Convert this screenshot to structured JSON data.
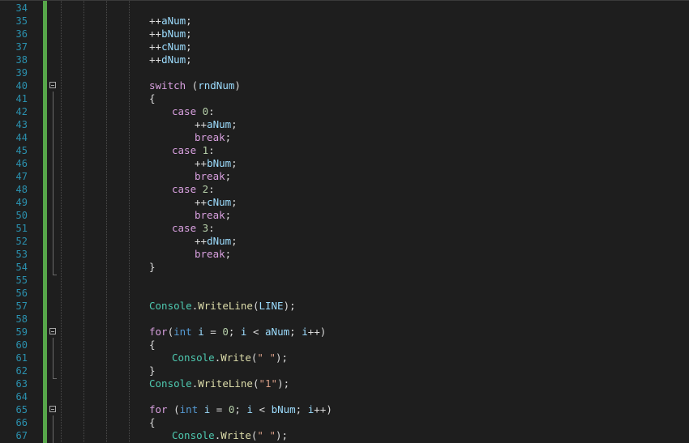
{
  "editor": {
    "language": "C#",
    "colors": {
      "background": "#1e1e1e",
      "line_number": "#2b91af",
      "change_bar": "#57a64a",
      "keyword": "#569cd6",
      "control_keyword": "#d8a0df",
      "type": "#4ec9b0",
      "method": "#dcdcaa",
      "variable": "#9cdcfe",
      "number": "#b5cea8",
      "string": "#d69d85"
    },
    "lines": [
      {
        "n": "34",
        "indent": 0,
        "tokens": []
      },
      {
        "n": "35",
        "indent": 0,
        "tokens": [
          [
            "pun",
            "++"
          ],
          [
            "var",
            "aNum"
          ],
          [
            "pun",
            ";"
          ]
        ]
      },
      {
        "n": "36",
        "indent": 0,
        "tokens": [
          [
            "pun",
            "++"
          ],
          [
            "var",
            "bNum"
          ],
          [
            "pun",
            ";"
          ]
        ]
      },
      {
        "n": "37",
        "indent": 0,
        "tokens": [
          [
            "pun",
            "++"
          ],
          [
            "var",
            "cNum"
          ],
          [
            "pun",
            ";"
          ]
        ]
      },
      {
        "n": "38",
        "indent": 0,
        "tokens": [
          [
            "pun",
            "++"
          ],
          [
            "var",
            "dNum"
          ],
          [
            "pun",
            ";"
          ]
        ]
      },
      {
        "n": "39",
        "indent": 0,
        "tokens": []
      },
      {
        "n": "40",
        "indent": 0,
        "fold": true,
        "tokens": [
          [
            "ctl",
            "switch"
          ],
          [
            "pun",
            " ("
          ],
          [
            "var",
            "rndNum"
          ],
          [
            "pun",
            ")"
          ]
        ]
      },
      {
        "n": "41",
        "indent": 0,
        "tokens": [
          [
            "pun",
            "{"
          ]
        ]
      },
      {
        "n": "42",
        "indent": 1,
        "tokens": [
          [
            "ctl",
            "case"
          ],
          [
            "pun",
            " "
          ],
          [
            "num",
            "0"
          ],
          [
            "pun",
            ":"
          ]
        ]
      },
      {
        "n": "43",
        "indent": 2,
        "tokens": [
          [
            "pun",
            "++"
          ],
          [
            "var",
            "aNum"
          ],
          [
            "pun",
            ";"
          ]
        ]
      },
      {
        "n": "44",
        "indent": 2,
        "tokens": [
          [
            "ctl",
            "break"
          ],
          [
            "pun",
            ";"
          ]
        ]
      },
      {
        "n": "45",
        "indent": 1,
        "tokens": [
          [
            "ctl",
            "case"
          ],
          [
            "pun",
            " "
          ],
          [
            "num",
            "1"
          ],
          [
            "pun",
            ":"
          ]
        ]
      },
      {
        "n": "46",
        "indent": 2,
        "tokens": [
          [
            "pun",
            "++"
          ],
          [
            "var",
            "bNum"
          ],
          [
            "pun",
            ";"
          ]
        ]
      },
      {
        "n": "47",
        "indent": 2,
        "tokens": [
          [
            "ctl",
            "break"
          ],
          [
            "pun",
            ";"
          ]
        ]
      },
      {
        "n": "48",
        "indent": 1,
        "tokens": [
          [
            "ctl",
            "case"
          ],
          [
            "pun",
            " "
          ],
          [
            "num",
            "2"
          ],
          [
            "pun",
            ":"
          ]
        ]
      },
      {
        "n": "49",
        "indent": 2,
        "tokens": [
          [
            "pun",
            "++"
          ],
          [
            "var",
            "cNum"
          ],
          [
            "pun",
            ";"
          ]
        ]
      },
      {
        "n": "50",
        "indent": 2,
        "tokens": [
          [
            "ctl",
            "break"
          ],
          [
            "pun",
            ";"
          ]
        ]
      },
      {
        "n": "51",
        "indent": 1,
        "tokens": [
          [
            "ctl",
            "case"
          ],
          [
            "pun",
            " "
          ],
          [
            "num",
            "3"
          ],
          [
            "pun",
            ":"
          ]
        ]
      },
      {
        "n": "52",
        "indent": 2,
        "tokens": [
          [
            "pun",
            "++"
          ],
          [
            "var",
            "dNum"
          ],
          [
            "pun",
            ";"
          ]
        ]
      },
      {
        "n": "53",
        "indent": 2,
        "tokens": [
          [
            "ctl",
            "break"
          ],
          [
            "pun",
            ";"
          ]
        ]
      },
      {
        "n": "54",
        "indent": 0,
        "tokens": [
          [
            "pun",
            "}"
          ]
        ]
      },
      {
        "n": "55",
        "indent": 0,
        "tokens": []
      },
      {
        "n": "56",
        "indent": 0,
        "tokens": []
      },
      {
        "n": "57",
        "indent": 0,
        "tokens": [
          [
            "ty",
            "Console"
          ],
          [
            "pun",
            "."
          ],
          [
            "mt",
            "WriteLine"
          ],
          [
            "pun",
            "("
          ],
          [
            "var",
            "LINE"
          ],
          [
            "pun",
            ");"
          ]
        ]
      },
      {
        "n": "58",
        "indent": 0,
        "tokens": []
      },
      {
        "n": "59",
        "indent": 0,
        "fold": true,
        "tokens": [
          [
            "ctl",
            "for"
          ],
          [
            "pun",
            "("
          ],
          [
            "kw",
            "int"
          ],
          [
            "pun",
            " "
          ],
          [
            "var",
            "i"
          ],
          [
            "pun",
            " = "
          ],
          [
            "num",
            "0"
          ],
          [
            "pun",
            "; "
          ],
          [
            "var",
            "i"
          ],
          [
            "pun",
            " < "
          ],
          [
            "var",
            "aNum"
          ],
          [
            "pun",
            "; "
          ],
          [
            "var",
            "i"
          ],
          [
            "pun",
            "++)"
          ]
        ]
      },
      {
        "n": "60",
        "indent": 0,
        "tokens": [
          [
            "pun",
            "{"
          ]
        ]
      },
      {
        "n": "61",
        "indent": 1,
        "tokens": [
          [
            "ty",
            "Console"
          ],
          [
            "pun",
            "."
          ],
          [
            "mt",
            "Write"
          ],
          [
            "pun",
            "("
          ],
          [
            "str",
            "\" \""
          ],
          [
            "pun",
            ");"
          ]
        ]
      },
      {
        "n": "62",
        "indent": 0,
        "tokens": [
          [
            "pun",
            "}"
          ]
        ]
      },
      {
        "n": "63",
        "indent": 0,
        "tokens": [
          [
            "ty",
            "Console"
          ],
          [
            "pun",
            "."
          ],
          [
            "mt",
            "WriteLine"
          ],
          [
            "pun",
            "("
          ],
          [
            "str",
            "\"1\""
          ],
          [
            "pun",
            ");"
          ]
        ]
      },
      {
        "n": "64",
        "indent": 0,
        "tokens": []
      },
      {
        "n": "65",
        "indent": 0,
        "fold": true,
        "tokens": [
          [
            "ctl",
            "for"
          ],
          [
            "pun",
            " ("
          ],
          [
            "kw",
            "int"
          ],
          [
            "pun",
            " "
          ],
          [
            "var",
            "i"
          ],
          [
            "pun",
            " = "
          ],
          [
            "num",
            "0"
          ],
          [
            "pun",
            "; "
          ],
          [
            "var",
            "i"
          ],
          [
            "pun",
            " < "
          ],
          [
            "var",
            "bNum"
          ],
          [
            "pun",
            "; "
          ],
          [
            "var",
            "i"
          ],
          [
            "pun",
            "++)"
          ]
        ]
      },
      {
        "n": "66",
        "indent": 0,
        "tokens": [
          [
            "pun",
            "{"
          ]
        ]
      },
      {
        "n": "67",
        "indent": 1,
        "tokens": [
          [
            "ty",
            "Console"
          ],
          [
            "pun",
            "."
          ],
          [
            "mt",
            "Write"
          ],
          [
            "pun",
            "("
          ],
          [
            "str",
            "\" \""
          ],
          [
            "pun",
            ");"
          ]
        ]
      }
    ]
  }
}
